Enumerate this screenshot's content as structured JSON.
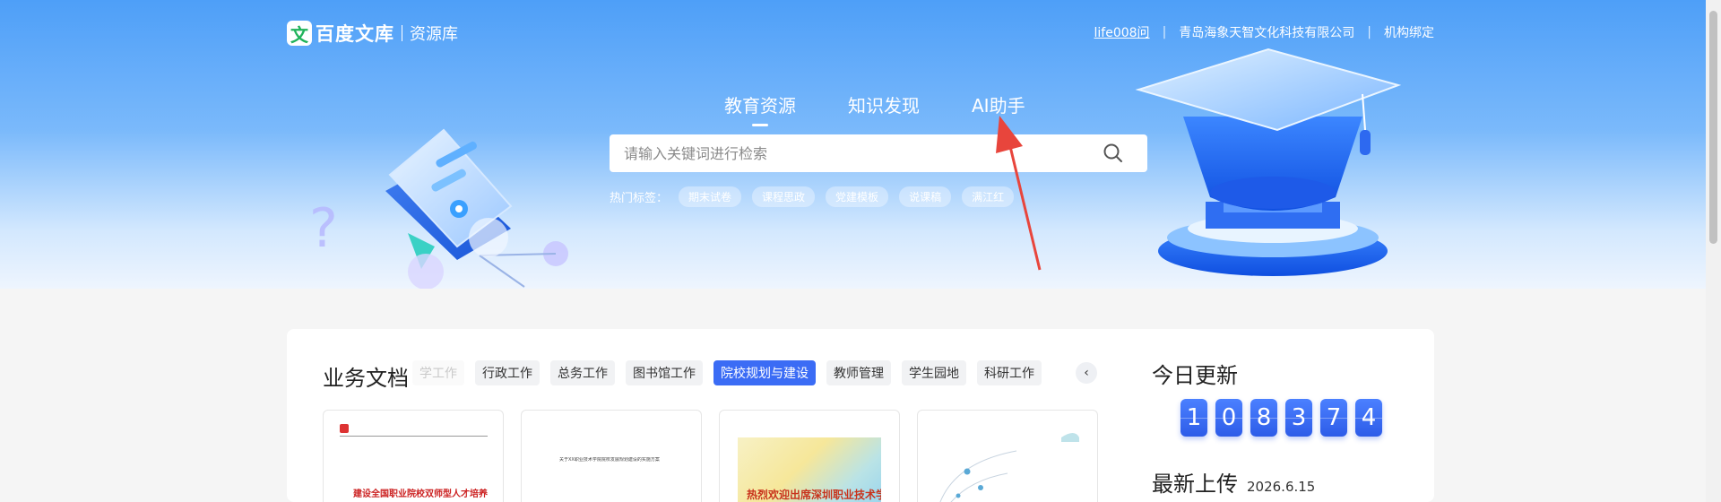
{
  "header": {
    "logo_mark": "文",
    "brand": "百度文库",
    "subtitle": "资源库",
    "user": "life008问",
    "org": "青岛海象天智文化科技有限公司",
    "bind": "机构绑定",
    "divider": "|"
  },
  "tabs": [
    {
      "label": "教育资源",
      "active": true
    },
    {
      "label": "知识发现",
      "active": false
    },
    {
      "label": "AI助手",
      "active": false
    }
  ],
  "search": {
    "placeholder": "请输入关键词进行检索",
    "value": ""
  },
  "hot_tags": {
    "label": "热门标签：",
    "tags": [
      "期末试卷",
      "课程思政",
      "党建模板",
      "说课稿",
      "满江红"
    ]
  },
  "business": {
    "title": "业务文档",
    "categories": [
      {
        "label": "学工作",
        "state": "faded"
      },
      {
        "label": "行政工作",
        "state": "normal"
      },
      {
        "label": "总务工作",
        "state": "normal"
      },
      {
        "label": "图书馆工作",
        "state": "normal"
      },
      {
        "label": "院校规划与建设",
        "state": "active"
      },
      {
        "label": "教师管理",
        "state": "normal"
      },
      {
        "label": "学生园地",
        "state": "normal"
      },
      {
        "label": "科研工作",
        "state": "normal"
      }
    ],
    "prev_arrow": "‹",
    "cards": [
      {
        "headline": "建设全国职业院校双师型人才培养基地",
        "icon": "document-thumbnail"
      },
      {
        "headline": "关于XX职业技术学院院校发展规划建设的实施方案",
        "icon": "document-thumbnail"
      },
      {
        "headline": "热烈欢迎出席深圳职业技术学院",
        "icon": "poster-thumbnail"
      },
      {
        "headline": "",
        "icon": "diagram-thumbnail"
      }
    ]
  },
  "today": {
    "title": "今日更新",
    "digits": [
      "1",
      "0",
      "8",
      "3",
      "7",
      "4"
    ]
  },
  "latest": {
    "title": "最新上传",
    "date": "2026.6.15"
  },
  "colors": {
    "accent": "#3b6cf5",
    "brand_green": "#21b35b",
    "annotation_red": "#e8453c"
  }
}
